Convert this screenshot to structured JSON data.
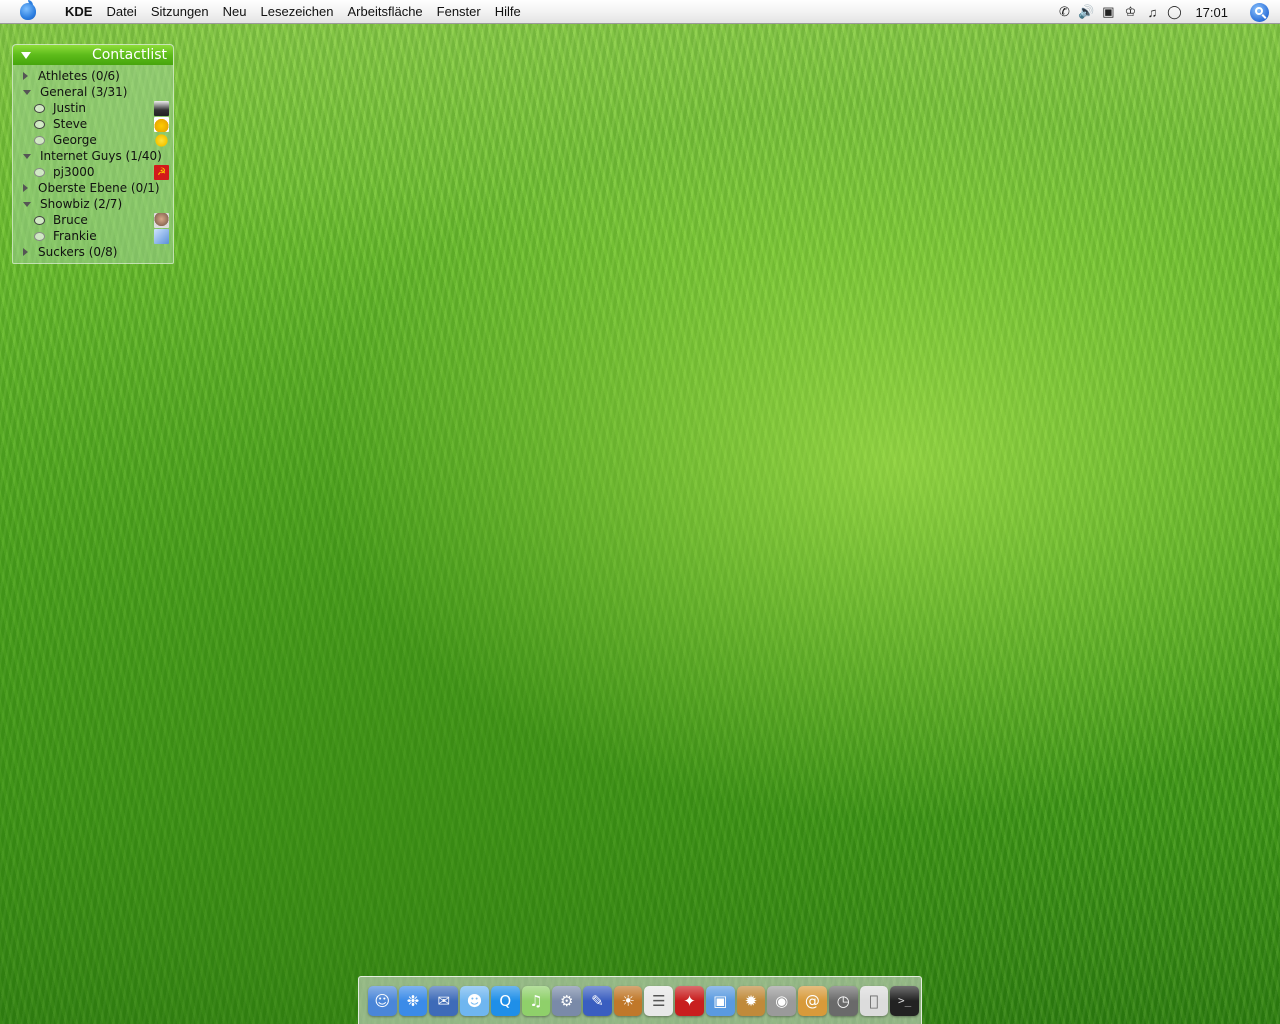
{
  "menubar": {
    "app_name": "KDE",
    "items": [
      "Datei",
      "Sitzungen",
      "Neu",
      "Lesezeichen",
      "Arbeitsfläche",
      "Fenster",
      "Hilfe"
    ],
    "clock": "17:01",
    "status_icons": [
      "phone-icon",
      "volume-icon",
      "display-icon",
      "chess-king-icon",
      "music-note-icon",
      "chat-bubble-icon"
    ]
  },
  "contactlist": {
    "title": "Contactlist",
    "groups": [
      {
        "label": "Athletes (0/6)",
        "expanded": false,
        "contacts": []
      },
      {
        "label": "General (3/31)",
        "expanded": true,
        "contacts": [
          "Justin",
          "Steve",
          "George"
        ]
      },
      {
        "label": "Internet Guys (1/40)",
        "expanded": true,
        "contacts": [
          "pj3000"
        ]
      },
      {
        "label": "Oberste Ebene (0/1)",
        "expanded": false,
        "contacts": []
      },
      {
        "label": "Showbiz (2/7)",
        "expanded": true,
        "contacts": [
          "Bruce",
          "Frankie"
        ]
      },
      {
        "label": "Suckers (0/8)",
        "expanded": false,
        "contacts": []
      }
    ]
  },
  "dock": {
    "apps": [
      "finder-icon",
      "safari-icon",
      "mail-stamp-icon",
      "ichat-icon",
      "quicktime-icon",
      "itunes-icon",
      "system-utility-icon",
      "notebook-icon",
      "iphoto-icon",
      "textedit-icon",
      "acrobat-icon",
      "preview-icon",
      "dashboard-icon",
      "network-icon",
      "address-book-icon",
      "clock-icon",
      "apple-icon",
      "terminal-icon"
    ],
    "colors": [
      "#4a86d8",
      "#3b8be8",
      "#3e6bb8",
      "#6fb6f0",
      "#1f8fe8",
      "#8fd06a",
      "#7a8aa8",
      "#3a5ec0",
      "#c0782a",
      "#e8e8e8",
      "#c81e1e",
      "#5a9ae0",
      "#c08a3a",
      "#9a9a9a",
      "#d89a3a",
      "#6a6a6a",
      "#dcdcdc",
      "#222222"
    ]
  }
}
